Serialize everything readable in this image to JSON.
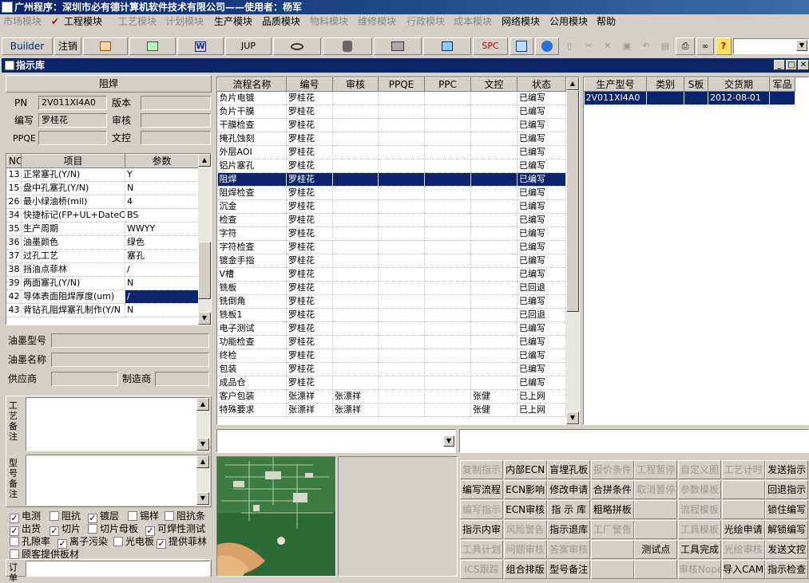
{
  "window_title": "广州程序：深圳市必有德计算机软件技术有限公司——使用者：杨军",
  "menu": [
    {
      "label": "市场模块",
      "enabled": false
    },
    {
      "label": "工程模块",
      "enabled": true
    },
    {
      "label": "工艺模块",
      "enabled": false
    },
    {
      "label": "计划模块",
      "enabled": false
    },
    {
      "label": "生产模块",
      "enabled": true
    },
    {
      "label": "品质模块",
      "enabled": true
    },
    {
      "label": "物料模块",
      "enabled": false
    },
    {
      "label": "维修模块",
      "enabled": false
    },
    {
      "label": "行政模块",
      "enabled": false
    },
    {
      "label": "成本模块",
      "enabled": false
    },
    {
      "label": "网络模块",
      "enabled": true
    },
    {
      "label": "公用模块",
      "enabled": true
    },
    {
      "label": "帮助",
      "enabled": true
    }
  ],
  "toolbar": {
    "builder": "Builder",
    "logout": "注销",
    "word": "W",
    "jup": "JUP",
    "spc": "SPC",
    "help": "?"
  },
  "subwindow_title": "指示库",
  "left": {
    "header": "阻焊",
    "pn_label": "PN",
    "pn_value": "2V011XI4A0",
    "version_label": "版本",
    "version_value": "",
    "editor_label": "编写",
    "editor_value": "罗桂花",
    "review_label": "审核",
    "review_value": "",
    "ppqe_label": "PPQE",
    "ppqe_value": "",
    "doc_label": "文控",
    "doc_value": "",
    "params_headers": [
      "NO",
      "项目",
      "参数"
    ],
    "params": [
      [
        "13",
        "正常塞孔(Y/N)",
        "Y"
      ],
      [
        "15",
        "盘中孔塞孔(Y/N)",
        "N"
      ],
      [
        "26",
        "最小绿油桥(mil)",
        "4"
      ],
      [
        "34",
        "快捷标记(FP+UL+DateCo",
        "BS"
      ],
      [
        "35",
        "生产周期",
        "WWYY"
      ],
      [
        "36",
        "油墨颜色",
        "绿色"
      ],
      [
        "37",
        "过孔工艺",
        "塞孔"
      ],
      [
        "38",
        "挡油点菲林",
        "/"
      ],
      [
        "39",
        "两面塞孔(Y/N)",
        "N"
      ],
      [
        "42",
        "导体表面阻焊厚度(um)",
        "/"
      ],
      [
        "43",
        "背钻孔阻焊塞孔制作(Y/N",
        "N"
      ]
    ],
    "ink_type_label": "油墨型号",
    "ink_type_value": "",
    "ink_name_label": "油墨名称",
    "ink_name_value": "",
    "supplier_label": "供应商",
    "supplier_value": "",
    "maker_label": "制造商",
    "maker_value": "",
    "process_note_label": "工艺备注",
    "model_note_label": "型号备注",
    "checkboxes": [
      {
        "label": "电测",
        "checked": true
      },
      {
        "label": "阻抗",
        "checked": false
      },
      {
        "label": "镀层",
        "checked": true
      },
      {
        "label": "锡样",
        "checked": false
      },
      {
        "label": "阻抗条",
        "checked": false
      },
      {
        "label": "出货",
        "checked": true
      },
      {
        "label": "切片",
        "checked": true
      },
      {
        "label": "切片母板",
        "checked": false
      },
      {
        "label": "可焊性测试",
        "checked": true
      },
      {
        "label": "孔隙率",
        "checked": false
      },
      {
        "label": "离子污染",
        "checked": true
      },
      {
        "label": "光电板",
        "checked": false
      },
      {
        "label": "提供菲林",
        "checked": true
      },
      {
        "label": "顾客提供板材",
        "checked": false
      }
    ],
    "order_label": "订单"
  },
  "process_grid": {
    "headers": [
      "流程名称",
      "编号",
      "审核",
      "PPQE",
      "PPC",
      "文控",
      "状态"
    ],
    "rows": [
      [
        "负片电镀",
        "罗桂花",
        "",
        "",
        "",
        "",
        "已编写"
      ],
      [
        "负片干膜",
        "罗桂花",
        "",
        "",
        "",
        "",
        "已编写"
      ],
      [
        "干膜检查",
        "罗桂花",
        "",
        "",
        "",
        "",
        "已编写"
      ],
      [
        "掩孔蚀刻",
        "罗桂花",
        "",
        "",
        "",
        "",
        "已编写"
      ],
      [
        "外层AOI",
        "罗桂花",
        "",
        "",
        "",
        "",
        "已编写"
      ],
      [
        "铝片塞孔",
        "罗桂花",
        "",
        "",
        "",
        "",
        "已编写"
      ],
      [
        "阻焊",
        "罗桂花",
        "",
        "",
        "",
        "",
        "已编写"
      ],
      [
        "阻焊检查",
        "罗桂花",
        "",
        "",
        "",
        "",
        "已编写"
      ],
      [
        "沉金",
        "罗桂花",
        "",
        "",
        "",
        "",
        "已编写"
      ],
      [
        "检查",
        "罗桂花",
        "",
        "",
        "",
        "",
        "已编写"
      ],
      [
        "字符",
        "罗桂花",
        "",
        "",
        "",
        "",
        "已编写"
      ],
      [
        "字符检查",
        "罗桂花",
        "",
        "",
        "",
        "",
        "已编写"
      ],
      [
        "镀金手指",
        "罗桂花",
        "",
        "",
        "",
        "",
        "已编写"
      ],
      [
        "V槽",
        "罗桂花",
        "",
        "",
        "",
        "",
        "已编写"
      ],
      [
        "铣板",
        "罗桂花",
        "",
        "",
        "",
        "",
        "已回退"
      ],
      [
        "铣倒角",
        "罗桂花",
        "",
        "",
        "",
        "",
        "已编写"
      ],
      [
        "铣板1",
        "罗桂花",
        "",
        "",
        "",
        "",
        "已回退"
      ],
      [
        "电子测试",
        "罗桂花",
        "",
        "",
        "",
        "",
        "已编写"
      ],
      [
        "功能检查",
        "罗桂花",
        "",
        "",
        "",
        "",
        "已编写"
      ],
      [
        "终检",
        "罗桂花",
        "",
        "",
        "",
        "",
        "已编写"
      ],
      [
        "包装",
        "罗桂花",
        "",
        "",
        "",
        "",
        "已编写"
      ],
      [
        "成品仓",
        "罗桂花",
        "",
        "",
        "",
        "",
        "已编写"
      ],
      [
        "客户包装",
        "张漂祥",
        "张漂祥",
        "",
        "",
        "张健",
        "已上网"
      ],
      [
        "特殊要求",
        "张漂祥",
        "张漂祥",
        "",
        "",
        "张健",
        "已上网"
      ]
    ],
    "selected_index": 6
  },
  "model_grid": {
    "headers": [
      "生产型号",
      "类别",
      "S板",
      "交货期",
      "军品"
    ],
    "rows": [
      [
        "2V011XI4A0",
        "",
        "",
        "2012-08-01",
        ""
      ]
    ]
  },
  "action_buttons": [
    [
      {
        "l": "复制指示",
        "e": false
      },
      {
        "l": "内部ECN",
        "e": true
      },
      {
        "l": "盲埋孔板",
        "e": true
      },
      {
        "l": "报价条件",
        "e": false
      },
      {
        "l": "工程暂停",
        "e": false
      },
      {
        "l": "自定义图",
        "e": false
      },
      {
        "l": "工艺计时",
        "e": false
      },
      {
        "l": "发送指示",
        "e": true
      }
    ],
    [
      {
        "l": "编写流程",
        "e": true
      },
      {
        "l": "ECN影响",
        "e": true
      },
      {
        "l": "修改申请",
        "e": true
      },
      {
        "l": "合拼条件",
        "e": true
      },
      {
        "l": "取消暂停",
        "e": false
      },
      {
        "l": "参数模板",
        "e": false
      },
      {
        "l": "",
        "e": false
      },
      {
        "l": "回退指示",
        "e": true
      }
    ],
    [
      {
        "l": "编写指示",
        "e": false
      },
      {
        "l": "ECN审核",
        "e": true
      },
      {
        "l": "指 示 库",
        "e": true
      },
      {
        "l": "粗略拼板",
        "e": true
      },
      {
        "l": "",
        "e": false
      },
      {
        "l": "流程模板",
        "e": false
      },
      {
        "l": "",
        "e": false
      },
      {
        "l": "锁住编写",
        "e": true
      }
    ],
    [
      {
        "l": "指示内审",
        "e": true
      },
      {
        "l": "风险警告",
        "e": false
      },
      {
        "l": "指示退库",
        "e": true
      },
      {
        "l": "工厂警告",
        "e": false
      },
      {
        "l": "",
        "e": false
      },
      {
        "l": "工具模板",
        "e": false
      },
      {
        "l": "光绘申请",
        "e": true
      },
      {
        "l": "解锁编写",
        "e": true
      }
    ],
    [
      {
        "l": "工具计划",
        "e": false
      },
      {
        "l": "问题审核",
        "e": false
      },
      {
        "l": "答案审核",
        "e": false
      },
      {
        "l": "",
        "e": false
      },
      {
        "l": "测试点",
        "e": true
      },
      {
        "l": "工具完成",
        "e": true
      },
      {
        "l": "光绘审核",
        "e": false
      },
      {
        "l": "发送文控",
        "e": true
      }
    ],
    [
      {
        "l": "ICS跟踪",
        "e": false
      },
      {
        "l": "组合排版",
        "e": true
      },
      {
        "l": "型号备注",
        "e": true
      },
      {
        "l": "",
        "e": false
      },
      {
        "l": "",
        "e": false
      },
      {
        "l": "审核Nope",
        "e": false
      },
      {
        "l": "导入CAM",
        "e": true
      },
      {
        "l": "指示检查",
        "e": true
      }
    ]
  ]
}
